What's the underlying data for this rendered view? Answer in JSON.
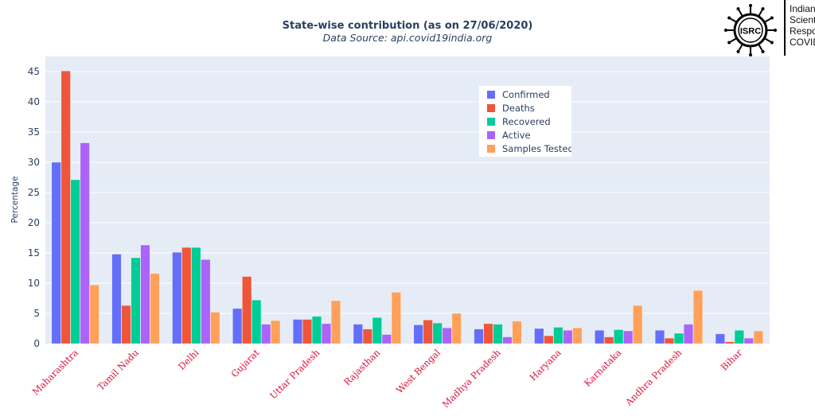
{
  "logo": {
    "badge_text": "ISRC",
    "text_lines": [
      "Indian",
      "Scient",
      "Respo",
      "COVID"
    ]
  },
  "chart_data": {
    "type": "bar",
    "title": "State-wise contribution (as on 27/06/2020)",
    "subtitle": "Data Source: api.covid19india.org",
    "xlabel": "",
    "ylabel": "Percentage",
    "ylim": [
      0,
      47.5
    ],
    "yticks": [
      0,
      5,
      10,
      15,
      20,
      25,
      30,
      35,
      40,
      45
    ],
    "grid": true,
    "legend_position": "top-right",
    "categories": [
      "Maharashtra",
      "Tamil Nadu",
      "Delhi",
      "Gujarat",
      "Uttar Pradesh",
      "Rajasthan",
      "West Bengal",
      "Madhya Pradesh",
      "Haryana",
      "Karnataka",
      "Andhra Pradesh",
      "Bihar"
    ],
    "category_label_color": "#dc143c",
    "series": [
      {
        "name": "Confirmed",
        "color": "#636efa",
        "values": [
          30.0,
          14.8,
          15.1,
          5.8,
          4.0,
          3.2,
          3.1,
          2.4,
          2.5,
          2.2,
          2.2,
          1.6
        ]
      },
      {
        "name": "Deaths",
        "color": "#ef553b",
        "values": [
          45.1,
          6.3,
          15.9,
          11.1,
          4.0,
          2.4,
          3.9,
          3.3,
          1.3,
          1.1,
          0.9,
          0.3
        ]
      },
      {
        "name": "Recovered",
        "color": "#00cc96",
        "values": [
          27.1,
          14.2,
          15.9,
          7.2,
          4.5,
          4.3,
          3.4,
          3.2,
          2.7,
          2.3,
          1.7,
          2.2
        ]
      },
      {
        "name": "Active",
        "color": "#ab63fa",
        "values": [
          33.2,
          16.3,
          13.9,
          3.2,
          3.3,
          1.5,
          2.6,
          1.1,
          2.2,
          2.1,
          3.2,
          0.9
        ]
      },
      {
        "name": "Samples Tested",
        "color": "#ffa15a",
        "values": [
          9.7,
          11.6,
          5.2,
          3.8,
          7.1,
          8.5,
          5.0,
          3.7,
          2.6,
          6.3,
          8.8,
          2.1
        ]
      }
    ]
  }
}
